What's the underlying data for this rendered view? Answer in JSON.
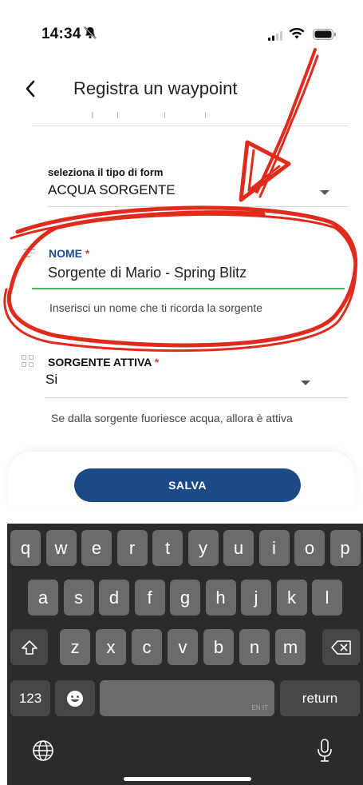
{
  "status": {
    "time": "14:34"
  },
  "header": {
    "back_icon": "chevron-left-icon",
    "title": "Registra un waypoint"
  },
  "form": {
    "type_label": "seleziona il tipo di form",
    "type_value": "ACQUA SORGENTE",
    "nome_label": "NOME",
    "nome_required": "*",
    "nome_value": "Sorgente di Mario - Spring Blitz",
    "nome_hint": "Inserisci un nome che ti ricorda la sorgente",
    "sorgente_label": "SORGENTE ATTIVA",
    "sorgente_required": "*",
    "sorgente_value": "Si",
    "sorgente_hint": "Se dalla sorgente fuoriesce acqua, allora è attiva"
  },
  "actions": {
    "save_label": "SALVA"
  },
  "keyboard": {
    "row1": [
      "q",
      "w",
      "e",
      "r",
      "t",
      "y",
      "u",
      "i",
      "o",
      "p"
    ],
    "row2": [
      "a",
      "s",
      "d",
      "f",
      "g",
      "h",
      "j",
      "k",
      "l"
    ],
    "row3": [
      "z",
      "x",
      "c",
      "v",
      "b",
      "n",
      "m"
    ],
    "numbers_label": "123",
    "space_lang": "EN IT",
    "return_label": "return"
  },
  "colors": {
    "primary": "#1c4a87",
    "label_blue": "#1c4c8c",
    "required": "#c9453f",
    "focus_line": "#4cb86a",
    "annotation_red": "#e02a1c"
  }
}
